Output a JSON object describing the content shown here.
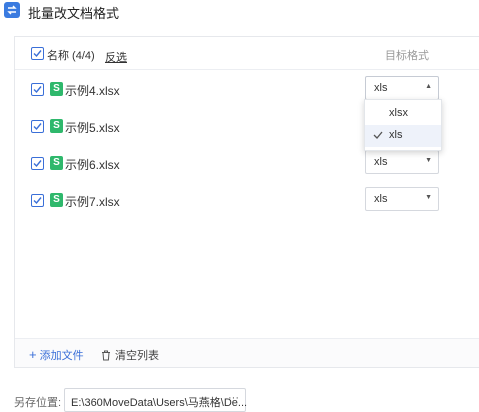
{
  "window": {
    "title": "批量改文档格式",
    "icon": "swap-icon",
    "accent_color": "#3a6fd8"
  },
  "list_header": {
    "name_label": "名称 (4/4)",
    "invert_label": "反选",
    "target_format_label": "目标格式",
    "all_checked": true
  },
  "files": [
    {
      "name": "示例4.xlsx",
      "checked": true,
      "format": "xls",
      "dropdown_open": true,
      "icon": "spreadsheet-icon",
      "icon_glyph": "S",
      "icon_color": "#2fb86c"
    },
    {
      "name": "示例5.xlsx",
      "checked": true,
      "format": "",
      "icon": "spreadsheet-icon",
      "icon_glyph": "S",
      "icon_color": "#2fb86c"
    },
    {
      "name": "示例6.xlsx",
      "checked": true,
      "format": "xls",
      "icon": "spreadsheet-icon",
      "icon_glyph": "S",
      "icon_color": "#2fb86c"
    },
    {
      "name": "示例7.xlsx",
      "checked": true,
      "format": "xls",
      "icon": "spreadsheet-icon",
      "icon_glyph": "S",
      "icon_color": "#2fb86c"
    }
  ],
  "format_dropdown": {
    "options": [
      {
        "label": "xlsx",
        "selected": false
      },
      {
        "label": "xls",
        "selected": true
      }
    ]
  },
  "footer": {
    "add_file_label": "添加文件",
    "clear_list_label": "清空列表"
  },
  "save_as": {
    "label": "另存位置:",
    "path": "E:\\360MoveData\\Users\\马燕格\\De...",
    "more": "···"
  }
}
